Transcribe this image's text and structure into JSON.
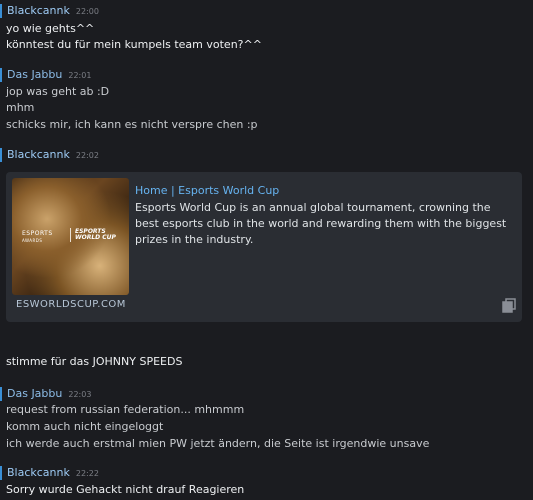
{
  "messages": [
    {
      "author": "Blackcannk",
      "time": "22:00",
      "lines": [
        "yo wie gehts^^",
        "könntest du für mein kumpels team voten?^^"
      ]
    },
    {
      "author": "Das Jabbu",
      "time": "22:01",
      "lines": [
        "jop was geht ab :D",
        "mhm",
        "schicks mir, ich kann es nicht verspre chen :p"
      ]
    },
    {
      "author": "Blackcannk",
      "time": "22:02",
      "embed": {
        "title": "Home | Esports World Cup",
        "description": "Esports World Cup is an annual global tournament, crowning the best esports club in the world and rewarding them with the biggest prizes in the industry.",
        "domain": "ESWORLDSCUP.COM",
        "thumb_logo_left": "ESPORTS\nAWARDS",
        "thumb_logo_right": "ESPORTS\nWORLD CUP"
      },
      "lines": [
        "stimme für das JOHNNY SPEEDS"
      ]
    },
    {
      "author": "Das Jabbu",
      "time": "22:03",
      "lines": [
        "request from russian federation... mhmmm",
        "komm auch nicht eingeloggt",
        "ich werde auch erstmal mien PW jetzt ändern, die Seite ist irgendwie unsave"
      ]
    },
    {
      "author": "Blackcannk",
      "time": "22:22",
      "lines": [
        "Sorry wurde Gehackt nicht drauf Reagieren"
      ]
    }
  ],
  "colors": {
    "background": "#1b1c20",
    "accent_bar": "#3a8fd6",
    "link": "#66b3f0"
  }
}
